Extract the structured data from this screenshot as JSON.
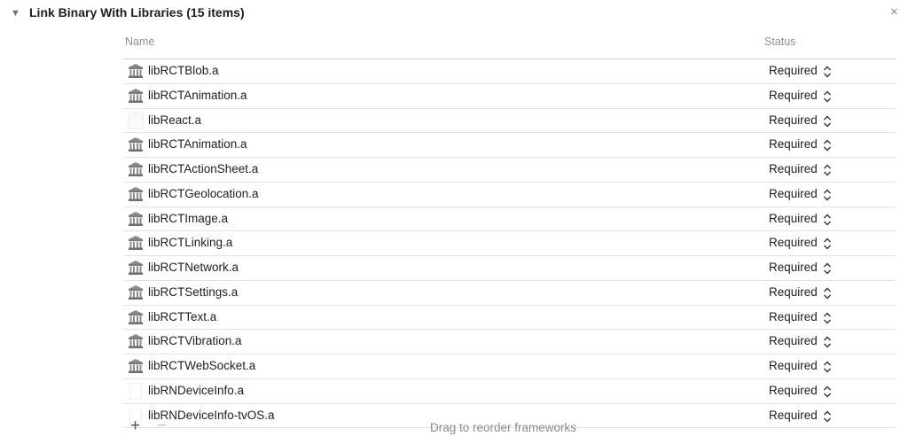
{
  "header": {
    "title": "Link Binary With Libraries (15 items)",
    "disclosure_icon": "triangle-down-icon",
    "close_glyph": "×"
  },
  "columns": {
    "name": "Name",
    "status": "Status"
  },
  "rows": [
    {
      "name": "libRCTBlob.a",
      "status": "Required",
      "icon": "library"
    },
    {
      "name": "libRCTAnimation.a",
      "status": "Required",
      "icon": "library"
    },
    {
      "name": "libReact.a",
      "status": "Required",
      "icon": "blank"
    },
    {
      "name": "libRCTAnimation.a",
      "status": "Required",
      "icon": "library"
    },
    {
      "name": "libRCTActionSheet.a",
      "status": "Required",
      "icon": "library"
    },
    {
      "name": "libRCTGeolocation.a",
      "status": "Required",
      "icon": "library"
    },
    {
      "name": "libRCTImage.a",
      "status": "Required",
      "icon": "library"
    },
    {
      "name": "libRCTLinking.a",
      "status": "Required",
      "icon": "library"
    },
    {
      "name": "libRCTNetwork.a",
      "status": "Required",
      "icon": "library"
    },
    {
      "name": "libRCTSettings.a",
      "status": "Required",
      "icon": "library"
    },
    {
      "name": "libRCTText.a",
      "status": "Required",
      "icon": "library"
    },
    {
      "name": "libRCTVibration.a",
      "status": "Required",
      "icon": "library"
    },
    {
      "name": "libRCTWebSocket.a",
      "status": "Required",
      "icon": "library"
    },
    {
      "name": "libRNDeviceInfo.a",
      "status": "Required",
      "icon": "page"
    },
    {
      "name": "libRNDeviceInfo-tvOS.a",
      "status": "Required",
      "icon": "page"
    }
  ],
  "footer": {
    "add_glyph": "+",
    "remove_glyph": "−",
    "hint": "Drag to reorder frameworks"
  }
}
